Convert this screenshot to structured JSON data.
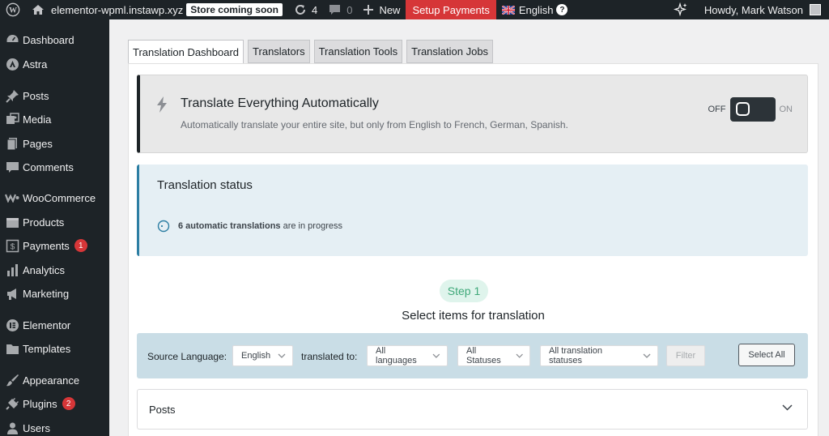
{
  "adminbar": {
    "site_name": "elementor-wpml.instawp.xyz",
    "coming_soon": "Store coming soon",
    "updates_count": "4",
    "comments_count": "0",
    "new_label": "New",
    "setup_payments": "Setup Payments",
    "language": "English",
    "howdy": "Howdy, Mark Watson"
  },
  "sidebar": {
    "items": [
      {
        "label": "Dashboard",
        "icon": "dashboard-icon"
      },
      {
        "label": "Astra",
        "icon": "astra-icon"
      },
      {
        "label": "Posts",
        "icon": "pin-icon"
      },
      {
        "label": "Media",
        "icon": "media-icon"
      },
      {
        "label": "Pages",
        "icon": "pages-icon"
      },
      {
        "label": "Comments",
        "icon": "comments-icon"
      },
      {
        "label": "WooCommerce",
        "icon": "woocommerce-icon"
      },
      {
        "label": "Products",
        "icon": "products-icon"
      },
      {
        "label": "Payments",
        "icon": "payments-icon",
        "badge": "1"
      },
      {
        "label": "Analytics",
        "icon": "analytics-icon"
      },
      {
        "label": "Marketing",
        "icon": "megaphone-icon"
      },
      {
        "label": "Elementor",
        "icon": "elementor-icon"
      },
      {
        "label": "Templates",
        "icon": "folder-icon"
      },
      {
        "label": "Appearance",
        "icon": "brush-icon"
      },
      {
        "label": "Plugins",
        "icon": "plugin-icon",
        "badge": "2"
      },
      {
        "label": "Users",
        "icon": "user-icon"
      }
    ]
  },
  "tabs": [
    {
      "label": "Translation Dashboard",
      "active": true
    },
    {
      "label": "Translators",
      "active": false
    },
    {
      "label": "Translation Tools",
      "active": false
    },
    {
      "label": "Translation Jobs",
      "active": false
    }
  ],
  "auto_translate": {
    "title": "Translate Everything Automatically",
    "description": "Automatically translate your entire site, but only from English to French, German, Spanish.",
    "off_label": "OFF",
    "on_label": "ON"
  },
  "status": {
    "title": "Translation status",
    "count_text": "6 automatic translations",
    "suffix": " are in progress"
  },
  "step": {
    "pill": "Step 1",
    "title": "Select items for translation"
  },
  "filter": {
    "source_label": "Source Language:",
    "source_value": "English",
    "translated_label": "translated to:",
    "languages_value": "All languages",
    "statuses_value": "All Statuses",
    "translation_statuses_value": "All translation statuses",
    "filter_button": "Filter",
    "select_all_button": "Select All"
  },
  "posts_section": {
    "label": "Posts"
  },
  "colors": {
    "admin_dark": "#1d2327",
    "accent_red": "#d63638",
    "status_bg": "#e5eff4",
    "step_green": "#3fa879"
  }
}
